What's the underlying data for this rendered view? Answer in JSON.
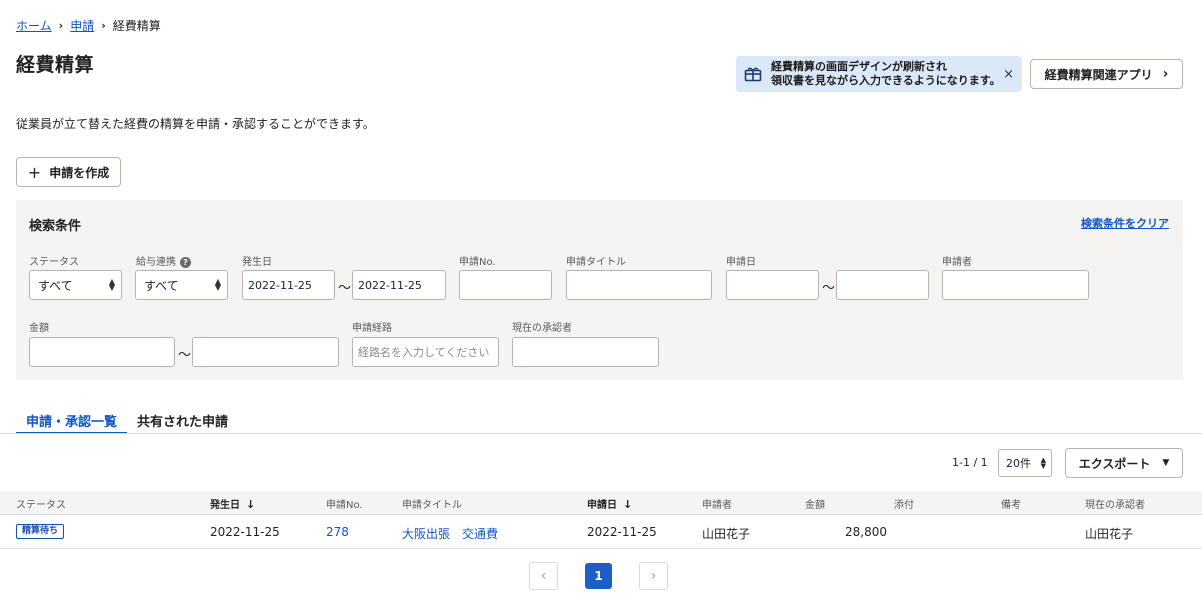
{
  "breadcrumb": {
    "home": "ホーム",
    "apply": "申請",
    "current": "経費精算",
    "sep": "›"
  },
  "page_title": "経費精算",
  "notice": {
    "line1": "経費精算の画面デザインが刷新され",
    "line2": "領収書を見ながら入力できるようになります。",
    "close": "×"
  },
  "related_app_button": "経費精算関連アプリ",
  "description": "従業員が立て替えた経費の精算を申請・承認することができます。",
  "create_button": "申請を作成",
  "search": {
    "title": "検索条件",
    "clear": "検索条件をクリア",
    "status": {
      "label": "ステータス",
      "value": "すべて"
    },
    "payroll": {
      "label": "給与連携",
      "value": "すべて",
      "help": "?"
    },
    "occurrence": {
      "label": "発生日",
      "from": "2022-11-25",
      "to": "2022-11-25"
    },
    "app_no": {
      "label": "申請No.",
      "value": ""
    },
    "app_title": {
      "label": "申請タイトル",
      "value": ""
    },
    "app_date": {
      "label": "申請日",
      "from": "",
      "to": ""
    },
    "applicant": {
      "label": "申請者",
      "value": ""
    },
    "amount": {
      "label": "金額",
      "from": "",
      "to": ""
    },
    "route": {
      "label": "申請経路",
      "placeholder": "経路名を入力してください"
    },
    "approver": {
      "label": "現在の承認者",
      "value": ""
    },
    "tilde": "～"
  },
  "tabs": [
    {
      "label": "申請・承認一覧",
      "active": true
    },
    {
      "label": "共有された申請",
      "active": false
    }
  ],
  "list": {
    "count": "1-1 / 1",
    "per_page": "20件",
    "export": "エクスポート",
    "columns": {
      "status": "ステータス",
      "occurrence_date": "発生日",
      "app_no": "申請No.",
      "app_title": "申請タイトル",
      "app_date": "申請日",
      "applicant": "申請者",
      "amount": "金額",
      "attachment": "添付",
      "note": "備考",
      "approver": "現在の承認者"
    },
    "rows": [
      {
        "status": "精算待ち",
        "occurrence_date": "2022-11-25",
        "app_no": "278",
        "app_title": "大阪出張　交通費",
        "app_date": "2022-11-25",
        "applicant": "山田花子",
        "amount": "28,800",
        "attachment": "",
        "note": "",
        "approver": "山田花子"
      }
    ]
  },
  "pagination": {
    "prev": "‹",
    "current": "1",
    "next": "›"
  },
  "colors": {
    "accent": "#0f56c6",
    "panel": "#f5f4f3",
    "notice_bg": "#dbe8f8"
  }
}
